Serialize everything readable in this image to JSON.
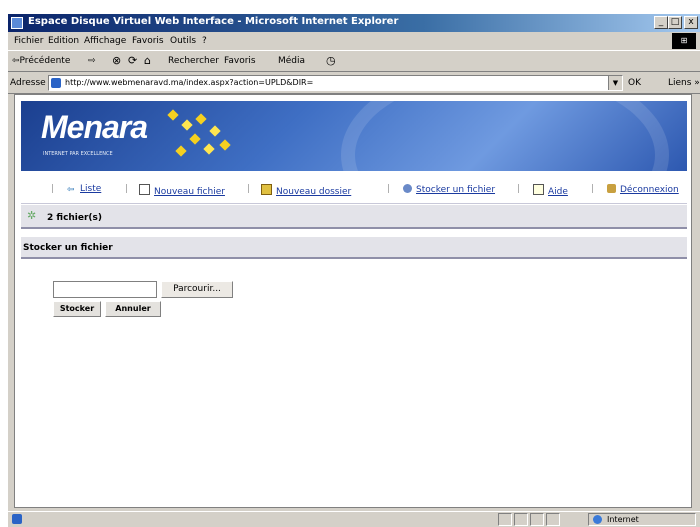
{
  "window": {
    "title": "Espace Disque Virtuel Web Interface - Microsoft Internet Explorer",
    "buttons": [
      "_",
      "□",
      "x"
    ]
  },
  "menu": {
    "items": [
      "Fichier",
      "Edition",
      "Affichage",
      "Favoris",
      "Outils",
      "?"
    ]
  },
  "toolbar": {
    "back_label": "⇦Précédente",
    "forward_label": "⇨",
    "stop_glyph": "⊗",
    "refresh_glyph": "⟳",
    "home_glyph": "⌂",
    "search_label": "Rechercher",
    "favorites_label": "Favoris",
    "media_label": "Média",
    "history_glyph": "◷"
  },
  "address": {
    "label": "Adresse",
    "url": "http://www.webmenaravd.ma/index.aspx?action=UPLD&DIR=",
    "go_label": "OK",
    "links_label": "Liens »"
  },
  "banner": {
    "logo": "Menara",
    "tagline": "INTERNET PAR EXCELLENCE"
  },
  "nav": {
    "items": [
      {
        "label": "Liste",
        "icon": "back-arrow-icon"
      },
      {
        "label": "Nouveau fichier",
        "icon": "new-file-icon"
      },
      {
        "label": "Nouveau dossier",
        "icon": "new-folder-icon"
      },
      {
        "label": "Stocker un fichier",
        "icon": "upload-icon"
      },
      {
        "label": "Aide",
        "icon": "help-icon"
      },
      {
        "label": "Déconnexion",
        "icon": "logout-icon"
      }
    ]
  },
  "status": {
    "file_count": "2 fichier(s)"
  },
  "section": {
    "title": "Stocker un fichier"
  },
  "form": {
    "file_value": "",
    "browse_label": "Parcourir...",
    "submit_label": "Stocker",
    "cancel_label": "Annuler"
  },
  "statusbar": {
    "zone": "Internet"
  },
  "colors": {
    "titlebar": "#0a246a",
    "link": "#1a3aa0",
    "section_bg": "#e3e3e9",
    "banner": "#3f6fc4"
  }
}
